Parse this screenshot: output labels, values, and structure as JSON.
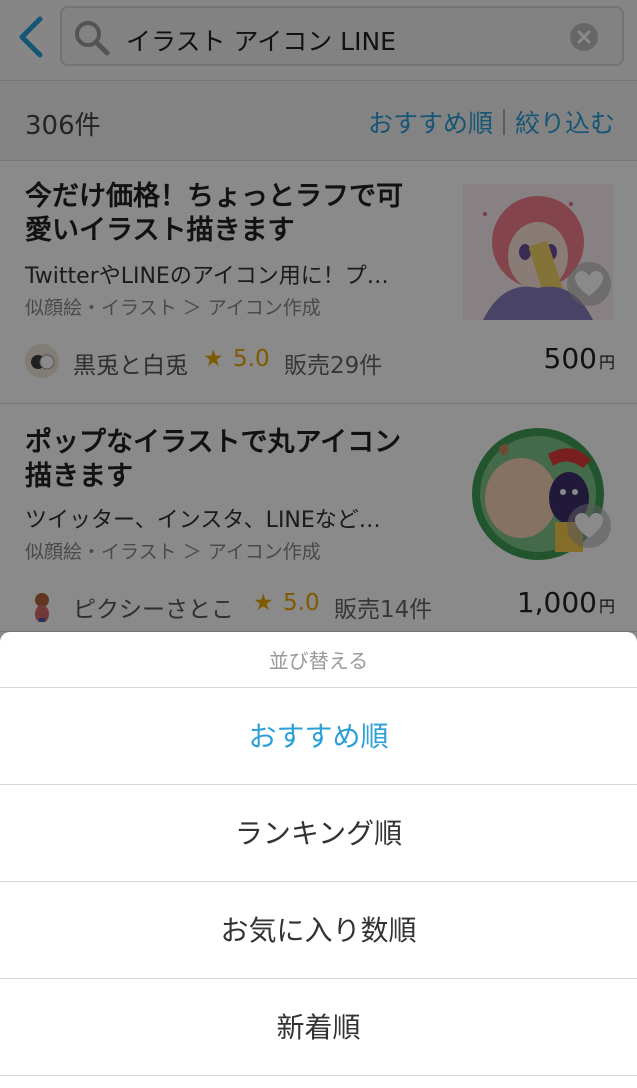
{
  "search": {
    "query": "イラスト アイコン LINE"
  },
  "summary": {
    "count": "306件",
    "sort_label": "おすすめ順",
    "filter_label": "絞り込む"
  },
  "listings": [
    {
      "title": "今だけ価格！ちょっとラフで可愛いイラスト描きます",
      "description": "TwitterやLINEのアイコン用に！プ…",
      "category": "似顔絵・イラスト ＞ アイコン作成",
      "seller": "黒兎と白兎",
      "rating": "5.0",
      "sales": "販売29件",
      "price": "500",
      "currency": "円"
    },
    {
      "title": "ポップなイラストで丸アイコン描きます",
      "description": "ツイッター、インスタ、LINEなど…",
      "category": "似顔絵・イラスト ＞ アイコン作成",
      "seller": "ピクシーさとこ",
      "rating": "5.0",
      "sales": "販売14件",
      "price": "1,000",
      "currency": "円"
    }
  ],
  "sort_sheet": {
    "title": "並び替える",
    "options": [
      "おすすめ順",
      "ランキング順",
      "お気に入り数順",
      "新着順"
    ],
    "selected": "おすすめ順"
  },
  "icons": {
    "back": "chevron-left-icon",
    "search": "search-icon",
    "clear": "clear-icon",
    "favorite": "heart-icon",
    "star": "star-icon"
  },
  "colors": {
    "accent": "#2aa0d7",
    "star": "#e9a800"
  }
}
